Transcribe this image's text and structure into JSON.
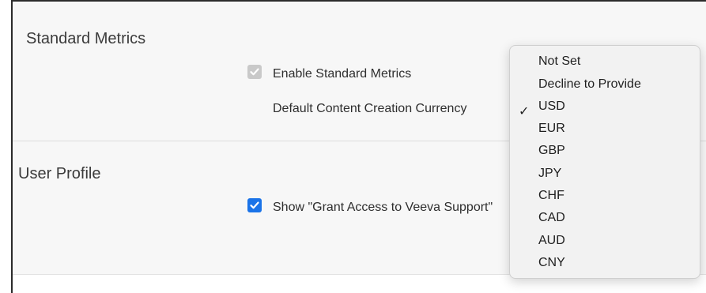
{
  "standard_metrics": {
    "title": "Standard Metrics",
    "enable_label": "Enable Standard Metrics",
    "enable_checked": true,
    "enable_disabled": true,
    "currency_label": "Default Content Creation Currency"
  },
  "user_profile": {
    "title": "User Profile",
    "grant_access_label": "Show \"Grant Access to Veeva Support\"",
    "grant_access_checked": true
  },
  "currency_dropdown": {
    "selected": "USD",
    "checkmark": "✓",
    "options": [
      "Not Set",
      "Decline to Provide",
      "USD",
      "EUR",
      "GBP",
      "JPY",
      "CHF",
      "CAD",
      "AUD",
      "CNY"
    ]
  },
  "colors": {
    "checkbox_active": "#1a73e8",
    "checkbox_disabled": "#c9c9c9"
  }
}
